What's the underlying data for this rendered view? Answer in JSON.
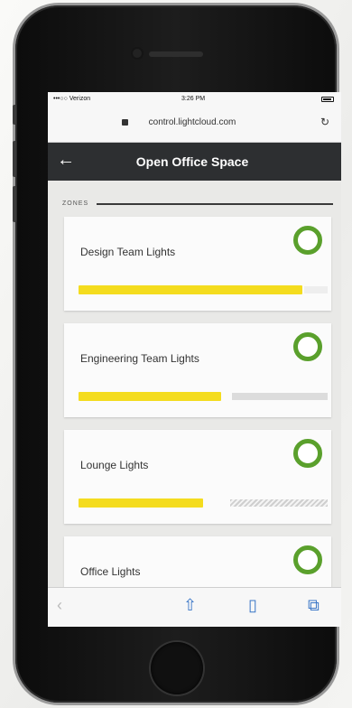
{
  "status_bar": {
    "carrier": "•••○○ Verizon",
    "time": "3:26 PM"
  },
  "browser": {
    "url": "control.lightcloud.com",
    "reload_glyph": "↻",
    "toolbar": {
      "back_glyph": "‹",
      "share_glyph": "⇧",
      "bookmarks_glyph": "▯",
      "tabs_glyph": "⧉"
    }
  },
  "header": {
    "back_glyph": "←",
    "title": "Open Office Space"
  },
  "zones_heading": "ZONES",
  "zones": [
    {
      "name": "Design Team Lights",
      "brightness": 0.9,
      "on": true
    },
    {
      "name": "Engineering Team Lights",
      "brightness": 0.57,
      "on": true
    },
    {
      "name": "Lounge Lights",
      "brightness": 0.5,
      "on": true
    },
    {
      "name": "Office Lights",
      "on": true
    }
  ],
  "colors": {
    "accent_green": "#5aa02c",
    "bar_yellow": "#f4dc1e",
    "header_bg": "#2d2f31"
  }
}
